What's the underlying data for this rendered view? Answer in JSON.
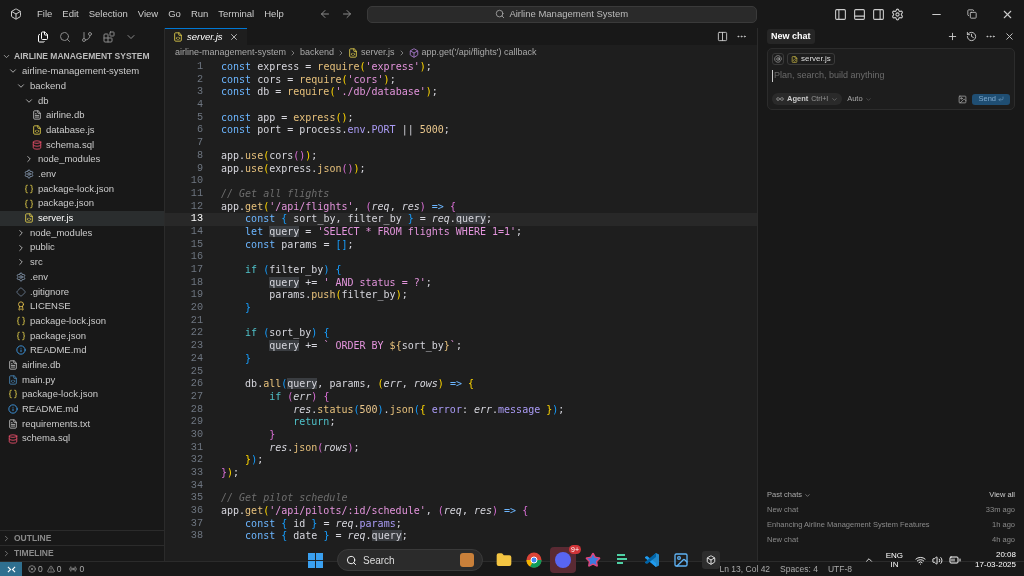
{
  "menu": [
    "File",
    "Edit",
    "Selection",
    "View",
    "Go",
    "Run",
    "Terminal",
    "Help"
  ],
  "command_center": "Airline Management System",
  "explorer": {
    "title": "AIRLINE MANAGEMENT SYSTEM",
    "expanded": true,
    "tree": [
      {
        "label": "airline-management-system",
        "kind": "folder",
        "expanded": true,
        "selected": false,
        "children": [
          {
            "label": "backend",
            "kind": "folder",
            "expanded": true,
            "selected": false,
            "children": [
              {
                "label": "db",
                "kind": "folder",
                "expanded": true,
                "selected": false,
                "children": [
                  {
                    "label": "airline.db",
                    "kind": "db",
                    "selected": false
                  },
                  {
                    "label": "database.js",
                    "kind": "js",
                    "selected": false
                  },
                  {
                    "label": "schema.sql",
                    "kind": "sql",
                    "selected": false
                  }
                ]
              },
              {
                "label": "node_modules",
                "kind": "folder",
                "expanded": false,
                "selected": false
              },
              {
                "label": ".env",
                "kind": "env",
                "selected": false
              },
              {
                "label": "package-lock.json",
                "kind": "json",
                "selected": false
              },
              {
                "label": "package.json",
                "kind": "json",
                "selected": false
              },
              {
                "label": "server.js",
                "kind": "js",
                "selected": true
              }
            ]
          },
          {
            "label": "node_modules",
            "kind": "folder",
            "expanded": false,
            "selected": false
          },
          {
            "label": "public",
            "kind": "folder",
            "expanded": false,
            "selected": false
          },
          {
            "label": "src",
            "kind": "folder",
            "expanded": false,
            "selected": false
          },
          {
            "label": ".env",
            "kind": "env",
            "selected": false
          },
          {
            "label": ".gitignore",
            "kind": "git",
            "selected": false
          },
          {
            "label": "LICENSE",
            "kind": "license",
            "selected": false
          },
          {
            "label": "package-lock.json",
            "kind": "json",
            "selected": false
          },
          {
            "label": "package.json",
            "kind": "json",
            "selected": false
          },
          {
            "label": "README.md",
            "kind": "md",
            "selected": false
          }
        ]
      },
      {
        "label": "airline.db",
        "kind": "db",
        "selected": false
      },
      {
        "label": "main.py",
        "kind": "py",
        "selected": false
      },
      {
        "label": "package-lock.json",
        "kind": "json",
        "selected": false
      },
      {
        "label": "README.md",
        "kind": "md",
        "selected": false
      },
      {
        "label": "requirements.txt",
        "kind": "txt",
        "selected": false
      },
      {
        "label": "schema.sql",
        "kind": "sql",
        "selected": false
      }
    ],
    "sections": [
      {
        "label": "OUTLINE",
        "expanded": false
      },
      {
        "label": "TIMELINE",
        "expanded": false
      }
    ]
  },
  "tabs": [
    {
      "label": "server.js",
      "kind": "js",
      "selected": true
    }
  ],
  "breadcrumbs": [
    {
      "label": "airline-management-system",
      "kind": "folder"
    },
    {
      "label": "backend",
      "kind": "folder"
    },
    {
      "label": "server.js",
      "kind": "js"
    },
    {
      "label": "app.get('/api/flights') callback",
      "kind": "symbol"
    }
  ],
  "code": [
    {
      "number": "1",
      "active": false,
      "tokens": [
        {
          "kind": "kw",
          "text": "const"
        },
        {
          "kind": "txt",
          "text": " express = "
        },
        {
          "kind": "fn",
          "text": "require"
        },
        {
          "kind": "b1",
          "text": "("
        },
        {
          "kind": "str",
          "text": "'express'"
        },
        {
          "kind": "b1",
          "text": ")"
        },
        {
          "kind": "txt",
          "text": ";"
        }
      ]
    },
    {
      "number": "2",
      "active": false,
      "tokens": [
        {
          "kind": "kw",
          "text": "const"
        },
        {
          "kind": "txt",
          "text": " cors = "
        },
        {
          "kind": "fn",
          "text": "require"
        },
        {
          "kind": "b1",
          "text": "("
        },
        {
          "kind": "str",
          "text": "'cors'"
        },
        {
          "kind": "b1",
          "text": ")"
        },
        {
          "kind": "txt",
          "text": ";"
        }
      ]
    },
    {
      "number": "3",
      "active": false,
      "tokens": [
        {
          "kind": "kw",
          "text": "const"
        },
        {
          "kind": "txt",
          "text": " db = "
        },
        {
          "kind": "fn",
          "text": "require"
        },
        {
          "kind": "b1",
          "text": "("
        },
        {
          "kind": "str",
          "text": "'./db/database'"
        },
        {
          "kind": "b1",
          "text": ")"
        },
        {
          "kind": "txt",
          "text": ";"
        }
      ]
    },
    {
      "number": "4",
      "active": false
    },
    {
      "number": "5",
      "active": false,
      "tokens": [
        {
          "kind": "kw",
          "text": "const"
        },
        {
          "kind": "txt",
          "text": " app = "
        },
        {
          "kind": "fn",
          "text": "express"
        },
        {
          "kind": "b1",
          "text": "()"
        },
        {
          "kind": "txt",
          "text": ";"
        }
      ]
    },
    {
      "number": "6",
      "active": false,
      "tokens": [
        {
          "kind": "kw",
          "text": "const"
        },
        {
          "kind": "txt",
          "text": " port = process."
        },
        {
          "kind": "prop",
          "text": "env"
        },
        {
          "kind": "txt",
          "text": "."
        },
        {
          "kind": "prop",
          "text": "PORT"
        },
        {
          "kind": "txt",
          "text": " || "
        },
        {
          "kind": "num",
          "text": "5000"
        },
        {
          "kind": "txt",
          "text": ";"
        }
      ]
    },
    {
      "number": "7",
      "active": false
    },
    {
      "number": "8",
      "active": false,
      "tokens": [
        {
          "kind": "txt",
          "text": "app."
        },
        {
          "kind": "fn",
          "text": "use"
        },
        {
          "kind": "b1",
          "text": "("
        },
        {
          "kind": "txt",
          "text": "cors"
        },
        {
          "kind": "b2",
          "text": "()"
        },
        {
          "kind": "b1",
          "text": ")"
        },
        {
          "kind": "txt",
          "text": ";"
        }
      ]
    },
    {
      "number": "9",
      "active": false,
      "tokens": [
        {
          "kind": "txt",
          "text": "app."
        },
        {
          "kind": "fn",
          "text": "use"
        },
        {
          "kind": "b1",
          "text": "("
        },
        {
          "kind": "txt",
          "text": "express."
        },
        {
          "kind": "fn",
          "text": "json"
        },
        {
          "kind": "b2",
          "text": "()"
        },
        {
          "kind": "b1",
          "text": ")"
        },
        {
          "kind": "txt",
          "text": ";"
        }
      ]
    },
    {
      "number": "10",
      "active": false
    },
    {
      "number": "11",
      "active": false,
      "tokens": [
        {
          "kind": "cmt",
          "text": "// Get all flights"
        }
      ]
    },
    {
      "number": "12",
      "active": false,
      "tokens": [
        {
          "kind": "txt",
          "text": "app."
        },
        {
          "kind": "fn",
          "text": "get"
        },
        {
          "kind": "b1",
          "text": "("
        },
        {
          "kind": "str",
          "text": "'/api/flights'"
        },
        {
          "kind": "txt",
          "text": ", "
        },
        {
          "kind": "b2",
          "text": "("
        },
        {
          "kind": "param",
          "text": "req"
        },
        {
          "kind": "txt",
          "text": ", "
        },
        {
          "kind": "param",
          "text": "res"
        },
        {
          "kind": "b2",
          "text": ")"
        },
        {
          "kind": "kw",
          "text": " =>"
        },
        {
          "kind": "b2",
          "text": " {"
        }
      ]
    },
    {
      "number": "13",
      "active": true,
      "tokens": [
        {
          "kind": "kw",
          "text": "    const"
        },
        {
          "kind": "b3",
          "text": " {"
        },
        {
          "kind": "txt",
          "text": " sort_by, filter_by "
        },
        {
          "kind": "b3",
          "text": "}"
        },
        {
          "kind": "txt",
          "text": " = "
        },
        {
          "kind": "param",
          "text": "req"
        },
        {
          "kind": "txt",
          "text": "."
        },
        {
          "kind": "match",
          "text": "query"
        },
        {
          "kind": "txt",
          "text": ";"
        }
      ]
    },
    {
      "number": "14",
      "active": false,
      "tokens": [
        {
          "kind": "kw",
          "text": "    let"
        },
        {
          "kind": "match",
          "text": " query"
        },
        {
          "kind": "txt",
          "text": " = "
        },
        {
          "kind": "str",
          "text": "'SELECT * FROM flights WHERE 1=1'"
        },
        {
          "kind": "txt",
          "text": ";"
        }
      ]
    },
    {
      "number": "15",
      "active": false,
      "tokens": [
        {
          "kind": "kw",
          "text": "    const"
        },
        {
          "kind": "txt",
          "text": " params = "
        },
        {
          "kind": "b3",
          "text": "[]"
        },
        {
          "kind": "txt",
          "text": ";"
        }
      ]
    },
    {
      "number": "16",
      "active": false
    },
    {
      "number": "17",
      "active": false,
      "tokens": [
        {
          "kind": "ctl",
          "text": "    if"
        },
        {
          "kind": "b3",
          "text": " ("
        },
        {
          "kind": "txt",
          "text": "filter_by"
        },
        {
          "kind": "b3",
          "text": ") {"
        }
      ]
    },
    {
      "number": "18",
      "active": false,
      "tokens": [
        {
          "kind": "match",
          "text": "        query"
        },
        {
          "kind": "txt",
          "text": " += "
        },
        {
          "kind": "str",
          "text": "' AND status = ?'"
        },
        {
          "kind": "txt",
          "text": ";"
        }
      ]
    },
    {
      "number": "19",
      "active": false,
      "tokens": [
        {
          "kind": "txt",
          "text": "        params."
        },
        {
          "kind": "fn",
          "text": "push"
        },
        {
          "kind": "b1",
          "text": "("
        },
        {
          "kind": "txt",
          "text": "filter_by"
        },
        {
          "kind": "b1",
          "text": ")"
        },
        {
          "kind": "txt",
          "text": ";"
        }
      ]
    },
    {
      "number": "20",
      "active": false,
      "tokens": [
        {
          "kind": "b3",
          "text": "    }"
        }
      ]
    },
    {
      "number": "21",
      "active": false
    },
    {
      "number": "22",
      "active": false,
      "tokens": [
        {
          "kind": "ctl",
          "text": "    if"
        },
        {
          "kind": "b3",
          "text": " ("
        },
        {
          "kind": "txt",
          "text": "sort_by"
        },
        {
          "kind": "b3",
          "text": ") {"
        }
      ]
    },
    {
      "number": "23",
      "active": false,
      "tokens": [
        {
          "kind": "match",
          "text": "        query"
        },
        {
          "kind": "txt",
          "text": " += "
        },
        {
          "kind": "str",
          "text": "` ORDER BY "
        },
        {
          "kind": "fn",
          "text": "${"
        },
        {
          "kind": "txt",
          "text": "sort_by"
        },
        {
          "kind": "fn",
          "text": "}"
        },
        {
          "kind": "str",
          "text": "`"
        },
        {
          "kind": "txt",
          "text": ";"
        }
      ]
    },
    {
      "number": "24",
      "active": false,
      "tokens": [
        {
          "kind": "b3",
          "text": "    }"
        }
      ]
    },
    {
      "number": "25",
      "active": false
    },
    {
      "number": "26",
      "active": false,
      "tokens": [
        {
          "kind": "txt",
          "text": "    db."
        },
        {
          "kind": "fn",
          "text": "all"
        },
        {
          "kind": "b3",
          "text": "("
        },
        {
          "kind": "match",
          "text": "query"
        },
        {
          "kind": "txt",
          "text": ", params, "
        },
        {
          "kind": "b1",
          "text": "("
        },
        {
          "kind": "param",
          "text": "err"
        },
        {
          "kind": "txt",
          "text": ", "
        },
        {
          "kind": "param",
          "text": "rows"
        },
        {
          "kind": "b1",
          "text": ")"
        },
        {
          "kind": "kw",
          "text": " =>"
        },
        {
          "kind": "b1",
          "text": " {"
        }
      ]
    },
    {
      "number": "27",
      "active": false,
      "tokens": [
        {
          "kind": "ctl",
          "text": "        if"
        },
        {
          "kind": "b2",
          "text": " ("
        },
        {
          "kind": "param",
          "text": "err"
        },
        {
          "kind": "b2",
          "text": ") {"
        }
      ]
    },
    {
      "number": "28",
      "active": false,
      "tokens": [
        {
          "kind": "param",
          "text": "            res"
        },
        {
          "kind": "txt",
          "text": "."
        },
        {
          "kind": "fn",
          "text": "status"
        },
        {
          "kind": "b3",
          "text": "("
        },
        {
          "kind": "num",
          "text": "500"
        },
        {
          "kind": "b3",
          "text": ")"
        },
        {
          "kind": "txt",
          "text": "."
        },
        {
          "kind": "fn",
          "text": "json"
        },
        {
          "kind": "b3",
          "text": "("
        },
        {
          "kind": "b1",
          "text": "{"
        },
        {
          "kind": "prop",
          "text": " error"
        },
        {
          "kind": "txt",
          "text": ": "
        },
        {
          "kind": "param",
          "text": "err"
        },
        {
          "kind": "txt",
          "text": "."
        },
        {
          "kind": "prop",
          "text": "message"
        },
        {
          "kind": "b1",
          "text": " }"
        },
        {
          "kind": "b3",
          "text": ")"
        },
        {
          "kind": "txt",
          "text": ";"
        }
      ]
    },
    {
      "number": "29",
      "active": false,
      "tokens": [
        {
          "kind": "ctl",
          "text": "            return"
        },
        {
          "kind": "txt",
          "text": ";"
        }
      ]
    },
    {
      "number": "30",
      "active": false,
      "tokens": [
        {
          "kind": "b2",
          "text": "        }"
        }
      ]
    },
    {
      "number": "31",
      "active": false,
      "tokens": [
        {
          "kind": "param",
          "text": "        res"
        },
        {
          "kind": "txt",
          "text": "."
        },
        {
          "kind": "fn",
          "text": "json"
        },
        {
          "kind": "b2",
          "text": "("
        },
        {
          "kind": "param",
          "text": "rows"
        },
        {
          "kind": "b2",
          "text": ")"
        },
        {
          "kind": "txt",
          "text": ";"
        }
      ]
    },
    {
      "number": "32",
      "active": false,
      "tokens": [
        {
          "kind": "b1",
          "text": "    }"
        },
        {
          "kind": "b3",
          "text": ")"
        },
        {
          "kind": "txt",
          "text": ";"
        }
      ]
    },
    {
      "number": "33",
      "active": false,
      "tokens": [
        {
          "kind": "b2",
          "text": "}"
        },
        {
          "kind": "b1",
          "text": ")"
        },
        {
          "kind": "txt",
          "text": ";"
        }
      ]
    },
    {
      "number": "34",
      "active": false
    },
    {
      "number": "35",
      "active": false,
      "tokens": [
        {
          "kind": "cmt",
          "text": "// Get pilot schedule"
        }
      ]
    },
    {
      "number": "36",
      "active": false,
      "tokens": [
        {
          "kind": "txt",
          "text": "app."
        },
        {
          "kind": "fn",
          "text": "get"
        },
        {
          "kind": "b1",
          "text": "("
        },
        {
          "kind": "str",
          "text": "'/api/pilots/:id/schedule'"
        },
        {
          "kind": "txt",
          "text": ", "
        },
        {
          "kind": "b2",
          "text": "("
        },
        {
          "kind": "param",
          "text": "req"
        },
        {
          "kind": "txt",
          "text": ", "
        },
        {
          "kind": "param",
          "text": "res"
        },
        {
          "kind": "b2",
          "text": ")"
        },
        {
          "kind": "kw",
          "text": " =>"
        },
        {
          "kind": "b2",
          "text": " {"
        }
      ]
    },
    {
      "number": "37",
      "active": false,
      "tokens": [
        {
          "kind": "kw",
          "text": "    const"
        },
        {
          "kind": "b3",
          "text": " {"
        },
        {
          "kind": "txt",
          "text": " id "
        },
        {
          "kind": "b3",
          "text": "}"
        },
        {
          "kind": "txt",
          "text": " = "
        },
        {
          "kind": "param",
          "text": "req"
        },
        {
          "kind": "txt",
          "text": "."
        },
        {
          "kind": "prop",
          "text": "params"
        },
        {
          "kind": "txt",
          "text": ";"
        }
      ]
    },
    {
      "number": "38",
      "active": false,
      "tokens": [
        {
          "kind": "kw",
          "text": "    const"
        },
        {
          "kind": "b3",
          "text": " {"
        },
        {
          "kind": "txt",
          "text": " date "
        },
        {
          "kind": "b3",
          "text": "}"
        },
        {
          "kind": "txt",
          "text": " = "
        },
        {
          "kind": "param",
          "text": "req"
        },
        {
          "kind": "txt",
          "text": "."
        },
        {
          "kind": "match",
          "text": "query"
        },
        {
          "kind": "txt",
          "text": ";"
        }
      ]
    }
  ],
  "chat": {
    "title": "New chat",
    "context_file": "server.js",
    "placeholder": "Plan, search, build anything",
    "mode": "Agent",
    "mode_shortcut": "Ctrl+I",
    "model": "Auto",
    "send": "Send",
    "past_label": "Past chats",
    "view_all": "View all",
    "past": [
      {
        "title": "New chat",
        "time": "33m ago"
      },
      {
        "title": "Enhancing Airline Management System Features",
        "time": "1h ago"
      },
      {
        "title": "New chat",
        "time": "4h ago"
      }
    ]
  },
  "status": {
    "errors": "0",
    "warnings": "0",
    "ports": "0",
    "items": [
      "Ln 13, Col 42",
      "Spaces: 4",
      "UTF-8"
    ]
  },
  "taskbar": {
    "search": "Search",
    "apps": [
      {
        "kind": "folder"
      },
      {
        "kind": "browser"
      },
      {
        "kind": "chat",
        "badge": "9+"
      },
      {
        "kind": "star"
      },
      {
        "kind": "stream"
      },
      {
        "kind": "code"
      },
      {
        "kind": "photos"
      },
      {
        "kind": "cube"
      }
    ],
    "language": "ENG",
    "region": "IN",
    "time": "20:08",
    "date": "17-03-2025"
  }
}
